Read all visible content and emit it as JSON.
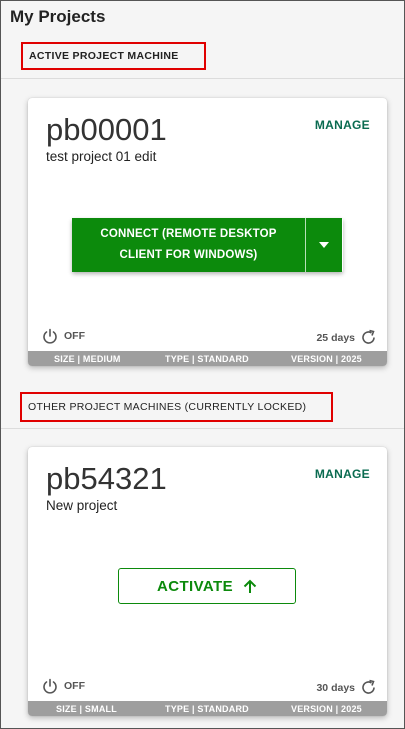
{
  "page": {
    "title": "My Projects"
  },
  "active_section": {
    "label": "ACTIVE PROJECT MACHINE"
  },
  "other_section": {
    "label": "OTHER PROJECT MACHINES (CURRENTLY LOCKED)"
  },
  "active_machine": {
    "id": "pb00001",
    "description": "test project 01 edit",
    "manage_label": "MANAGE",
    "connect_line1": "CONNECT (REMOTE DESKTOP",
    "connect_line2": "CLIENT FOR WINDOWS)",
    "power_status": "OFF",
    "days": "25 days",
    "size": "SIZE | MEDIUM",
    "type": "TYPE | STANDARD",
    "version": "VERSION | 2025"
  },
  "locked_machine": {
    "id": "pb54321",
    "description": "New project",
    "manage_label": "MANAGE",
    "activate_label": "ACTIVATE",
    "power_status": "OFF",
    "days": "30 days",
    "size": "SIZE | SMALL",
    "type": "TYPE | STANDARD",
    "version": "VERSION | 2025"
  },
  "colors": {
    "accent_green": "#0c8a0c",
    "manage_teal": "#0a6b50",
    "highlight_red": "#e00000",
    "footer_gray": "#9e9e9e"
  },
  "icons": [
    "power-icon",
    "refresh-icon",
    "chevron-down-icon",
    "arrow-up-icon"
  ]
}
